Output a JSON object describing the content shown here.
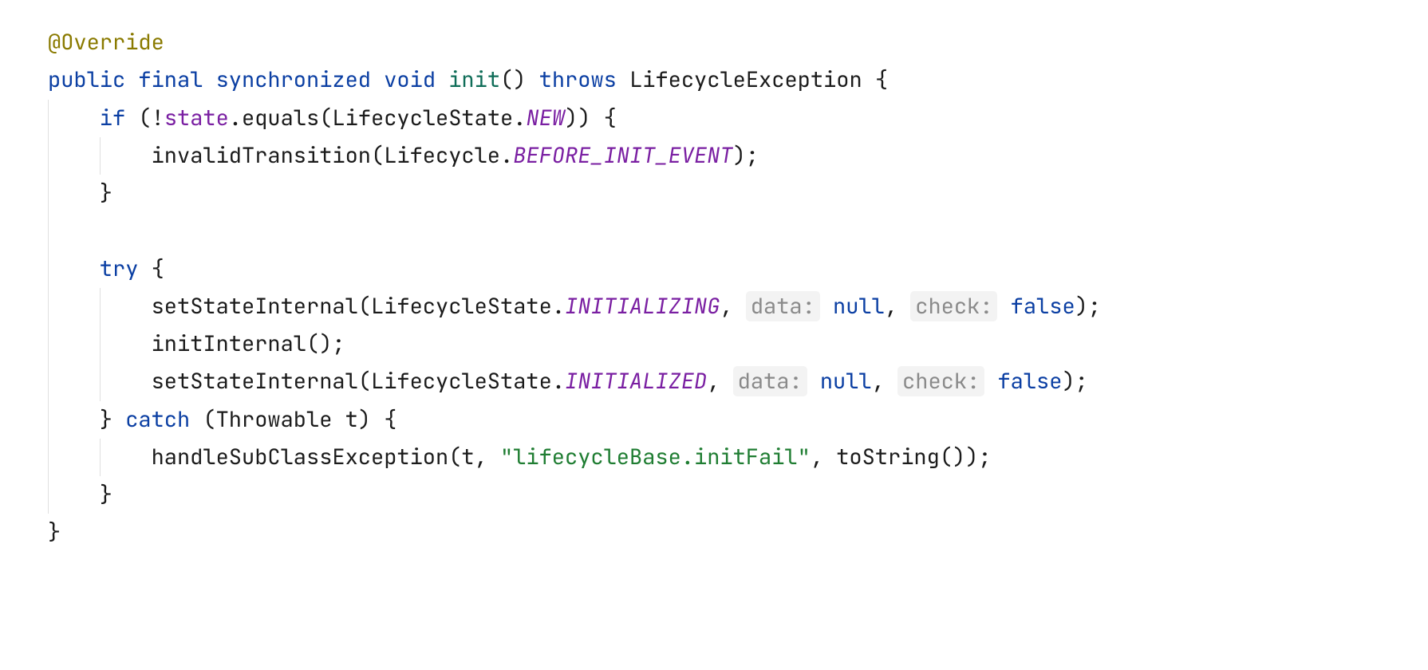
{
  "code": {
    "annotation": "@Override",
    "kw_public": "public",
    "kw_final": "final",
    "kw_synchronized": "synchronized",
    "kw_void": "void",
    "method_name": "init",
    "kw_throws": "throws",
    "exception_type": "LifecycleException",
    "kw_if": "if",
    "field_state": "state",
    "call_equals": ".equals(",
    "type_LifecycleState": "LifecycleState",
    "const_NEW": "NEW",
    "call_invalidTransition": "invalidTransition(",
    "type_Lifecycle": "Lifecycle",
    "const_BEFORE_INIT_EVENT": "BEFORE_INIT_EVENT",
    "kw_try": "try",
    "call_setStateInternal": "setStateInternal(",
    "const_INITIALIZING": "INITIALIZING",
    "hint_data": "data:",
    "kw_null": "null",
    "hint_check": "check:",
    "kw_false": "false",
    "call_initInternal": "initInternal();",
    "const_INITIALIZED": "INITIALIZED",
    "kw_catch": "catch",
    "catch_param": "(Throwable t) {",
    "call_handleSubClassException": "handleSubClassException(t, ",
    "string_initFail": "\"lifecycleBase.initFail\"",
    "handle_tail": ", toString());"
  }
}
